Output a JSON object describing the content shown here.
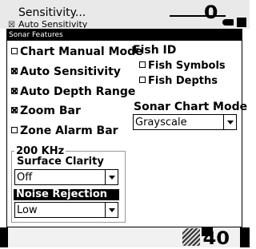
{
  "background": {
    "menu_first": "Sensitivity...",
    "menu_second": "Auto Sensitivity",
    "depth_top": "0",
    "depth_bottom": "40"
  },
  "dialog": {
    "title": "Sonar Features",
    "checkboxes": [
      {
        "label": "Chart Manual Mode",
        "checked": false
      },
      {
        "label": "Auto Sensitivity",
        "checked": true
      },
      {
        "label": "Auto Depth Range",
        "checked": true
      },
      {
        "label": "Zoom Bar",
        "checked": true
      },
      {
        "label": "Zone Alarm Bar",
        "checked": false
      }
    ],
    "fish_id": {
      "heading": "Fish ID",
      "options": [
        {
          "label": "Fish Symbols",
          "checked": false
        },
        {
          "label": "Fish Depths",
          "checked": false
        }
      ]
    },
    "sonar_chart_mode": {
      "label": "Sonar Chart Mode",
      "value": "Grayscale"
    },
    "group_200khz": {
      "label": "200 KHz",
      "surface_clarity": {
        "label": "Surface Clarity",
        "value": "Off"
      },
      "noise_rejection": {
        "label": "Noise Rejection",
        "value": "Low"
      }
    }
  }
}
